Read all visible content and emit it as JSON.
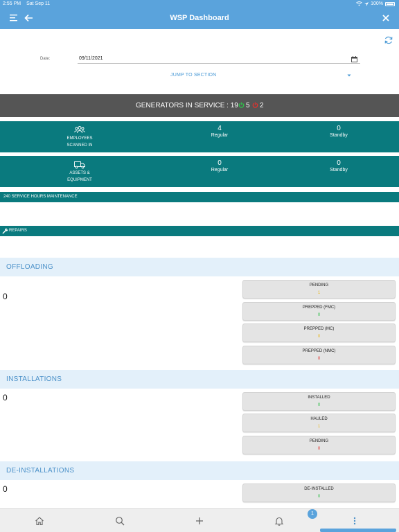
{
  "status_bar": {
    "time": "2:55 PM",
    "date": "Sat Sep 11",
    "battery": "100%"
  },
  "nav": {
    "title": "WSP Dashboard"
  },
  "date_filter": {
    "label": "Date:",
    "value": "09/11/2021"
  },
  "jump": {
    "label": "JUMP TO SECTION"
  },
  "generators": {
    "label": "GENERATORS IN SERVICE : 19",
    "green_count": "5",
    "red_count": "2",
    "green_color": "#2fbf4a",
    "red_color": "#e0332f"
  },
  "employees": {
    "label_line1": "EMPLOYEES",
    "label_line2": "SCANNED IN",
    "regular_value": "4",
    "regular_label": "Regular",
    "standby_value": "0",
    "standby_label": "Standby"
  },
  "assets": {
    "label_line1": "ASSETS &",
    "label_line2": "EQUIPMENT",
    "regular_value": "0",
    "regular_label": "Regular",
    "standby_value": "0",
    "standby_label": "Standby"
  },
  "maintenance": {
    "label": "240 SERVICE HOURS MAINTENANCE"
  },
  "repairs": {
    "label": "REPAIRS"
  },
  "offloading": {
    "title": "OFFLOADING",
    "count": "0",
    "cards": [
      {
        "title": "PENDING",
        "value": "1",
        "color": "#e8b81f"
      },
      {
        "title": "PREPPED (FMC)",
        "value": "0",
        "color": "#2fbf4a"
      },
      {
        "title": "PREPPED (MC)",
        "value": "0",
        "color": "#e8b81f"
      },
      {
        "title": "PREPPED (NMC)",
        "value": "0",
        "color": "#e0332f"
      }
    ]
  },
  "installations": {
    "title": "INSTALLATIONS",
    "count": "0",
    "cards": [
      {
        "title": "INSTALLED",
        "value": "0",
        "color": "#2fbf4a"
      },
      {
        "title": "HAULED",
        "value": "1",
        "color": "#e8b81f"
      },
      {
        "title": "PENDING",
        "value": "0",
        "color": "#e0332f"
      }
    ]
  },
  "deinstallations": {
    "title": "DE-INSTALLATIONS",
    "count": "0",
    "cards": [
      {
        "title": "DE-INSTALLED",
        "value": "0",
        "color": "#2fbf4a"
      }
    ]
  },
  "tabbar": {
    "notification_badge": "1"
  },
  "colors": {
    "accent": "#5aa3dc",
    "teal": "#0a7a7e",
    "gen_bar": "#555555",
    "section_bg": "#e3f0fa"
  }
}
